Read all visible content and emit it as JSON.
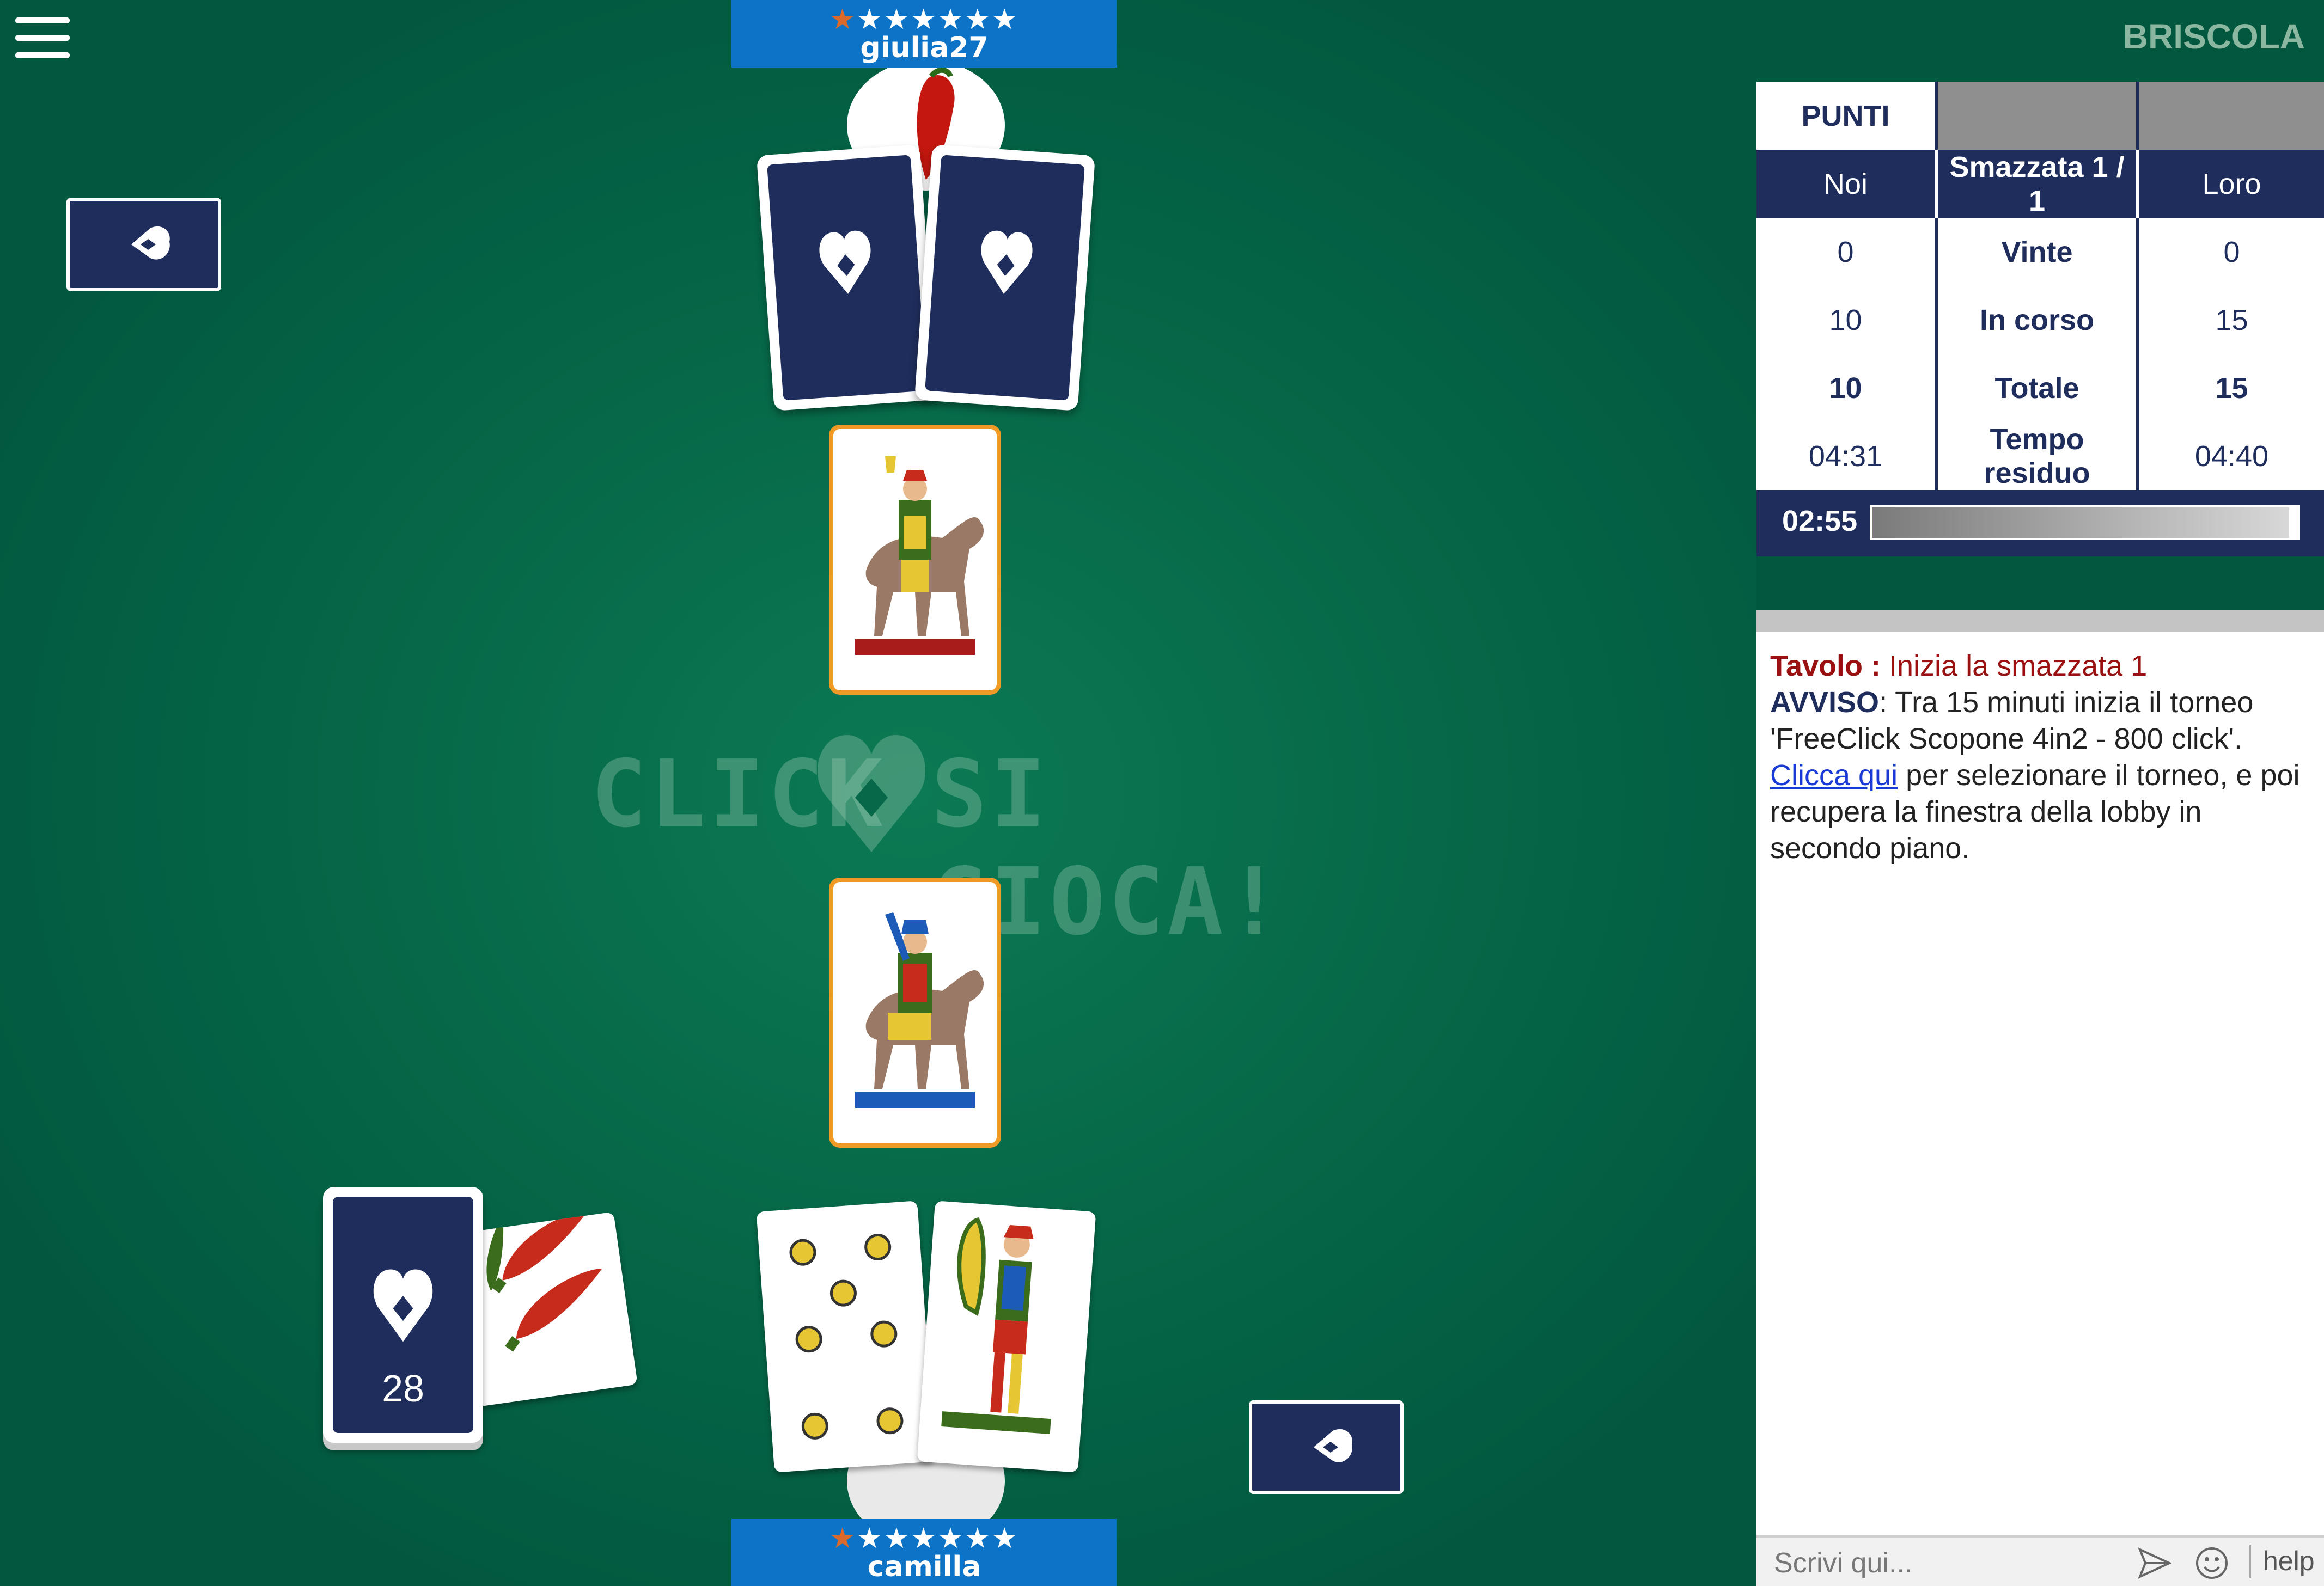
{
  "header": {
    "menu_icon": "hamburger-menu-icon",
    "app_title": "BRISCOLA"
  },
  "opponent": {
    "name": "giulia27",
    "rating": 1,
    "stars_total": 7,
    "stars": "★★★★★★★"
  },
  "player": {
    "name": "camilla",
    "rating": 1,
    "stars_total": 7,
    "stars": "★★★★★★★"
  },
  "table": {
    "watermark_left": "CLICK",
    "watermark_right": "SI GIOCA!",
    "deck_count": "28",
    "back_icon": "heart-logo-icon",
    "played_cards": [
      "Cavallo di Coppe",
      "Cavallo di Bastoni"
    ],
    "hand_cards": [
      "7 di Denari",
      "Fante di Bastoni"
    ],
    "briscola_card": "3 di Bastoni"
  },
  "score": {
    "punti_label": "PUNTI",
    "headers": {
      "noi": "Noi",
      "round": "Smazzata 1 / 1",
      "loro": "Loro"
    },
    "rows": [
      {
        "noi": "0",
        "label": "Vinte",
        "loro": "0"
      },
      {
        "noi": "10",
        "label": "In corso",
        "loro": "15"
      },
      {
        "noi": "10",
        "label": "Totale",
        "loro": "15"
      },
      {
        "noi": "04:31",
        "label": "Tempo residuo",
        "loro": "04:40"
      }
    ],
    "timer": "02:55",
    "timer_fraction": 0.98
  },
  "chat": {
    "line1_label": "Tavolo :",
    "line1_text": " Inizia la smazzata 1",
    "line2_label": "AVVISO",
    "line2_text": ": Tra 15 minuti inizia il torneo 'FreeClick Scopone 4in2 - 800 click'. ",
    "link_text": "Clicca qui",
    "line2_tail": " per selezionare il torneo, e poi recupera la finestra della lobby in secondo piano.",
    "placeholder": "Scrivi qui...",
    "help_label": "help"
  },
  "colors": {
    "felt": "#02583f",
    "navy": "#1f2d5c",
    "plate": "#0d73c6",
    "orange": "#ef9a25"
  }
}
